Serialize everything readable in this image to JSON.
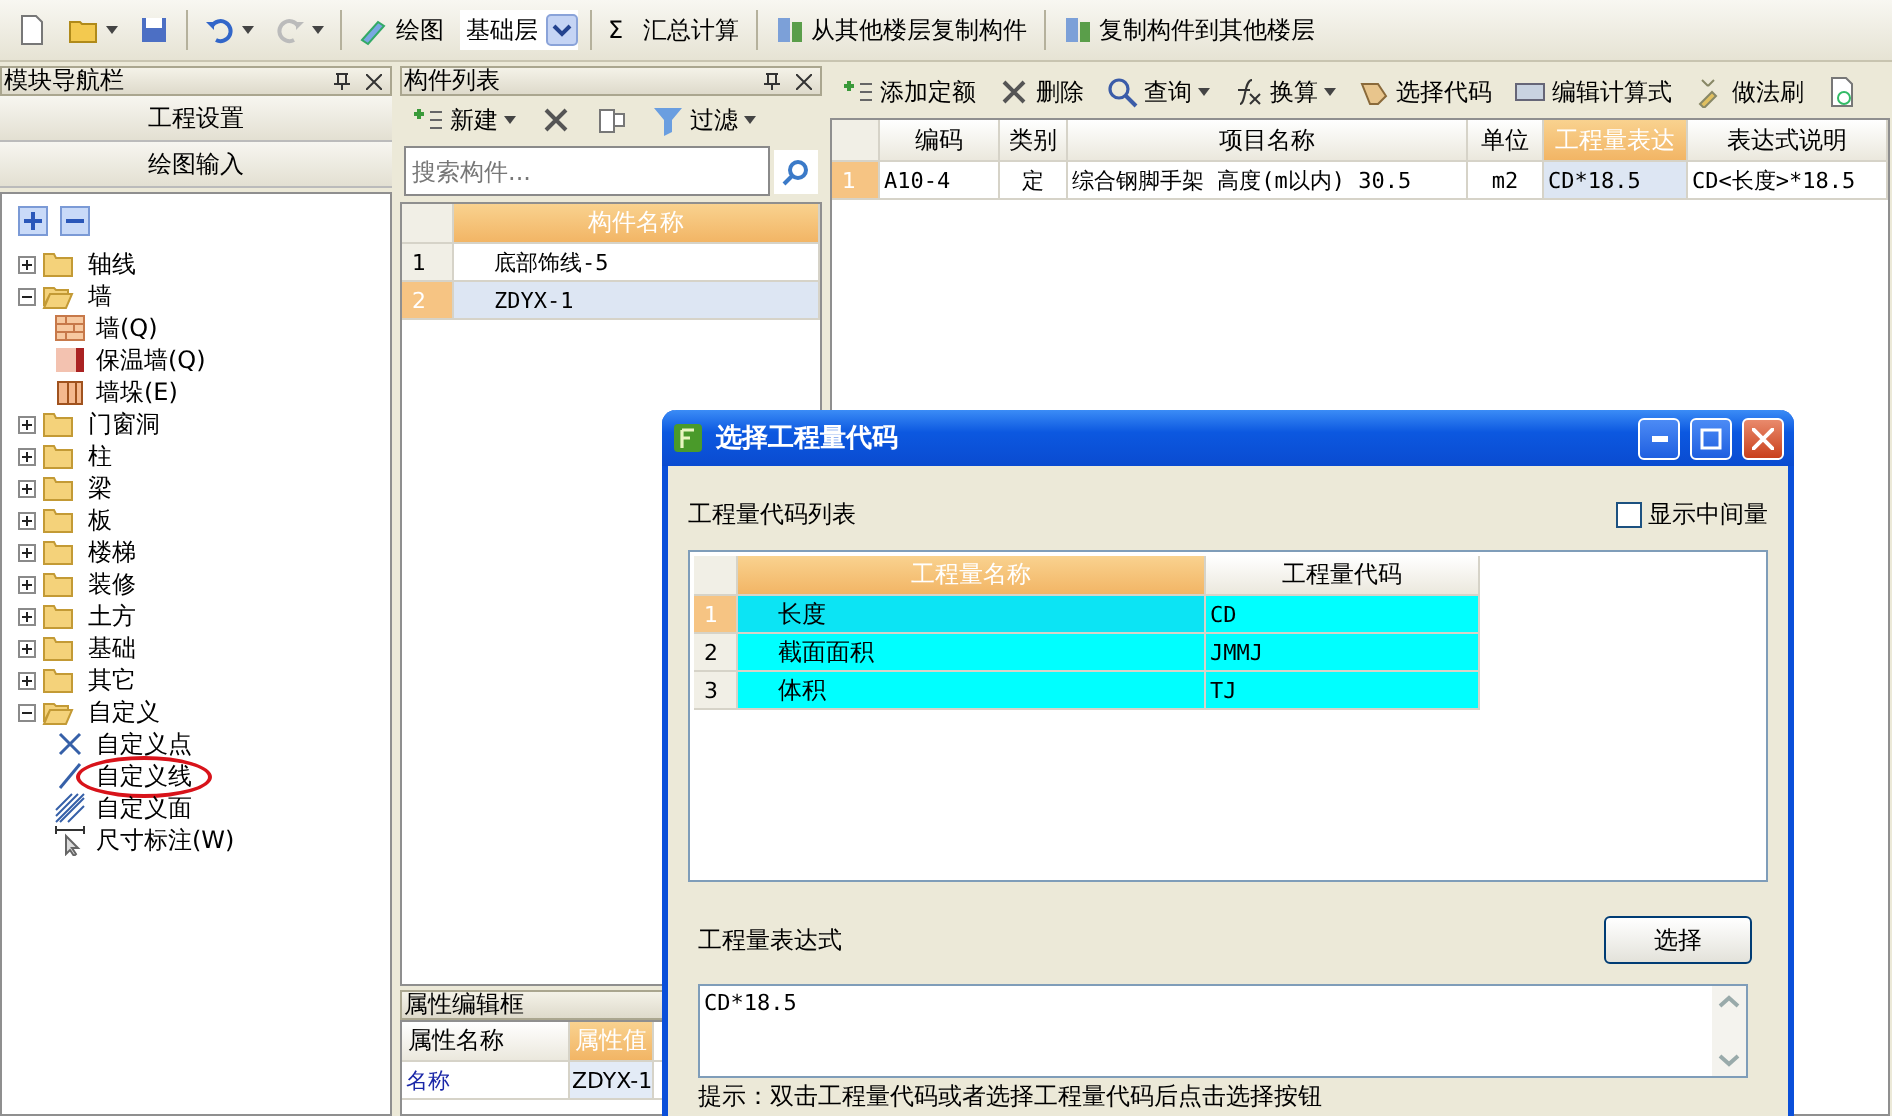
{
  "main_toolbar": {
    "redo_disabled": true,
    "draw": "绘图",
    "floor": "基础层",
    "sum_symbol": "Σ",
    "sum": "汇总计算",
    "copy_from": "从其他楼层复制构件",
    "copy_to": "复制构件到其他楼层"
  },
  "nav_panel": {
    "title": "模块导航栏",
    "sections": [
      "工程设置",
      "绘图输入"
    ],
    "tree": [
      {
        "label": "轴线",
        "kind": "folder",
        "expanded": false
      },
      {
        "label": "墙",
        "kind": "folder",
        "expanded": true,
        "children": [
          {
            "label": "墙(Q)",
            "kind": "wall"
          },
          {
            "label": "保温墙(Q)",
            "kind": "insulation"
          },
          {
            "label": "墙垛(E)",
            "kind": "pier"
          }
        ]
      },
      {
        "label": "门窗洞",
        "kind": "folder",
        "expanded": false
      },
      {
        "label": "柱",
        "kind": "folder",
        "expanded": false
      },
      {
        "label": "梁",
        "kind": "folder",
        "expanded": false
      },
      {
        "label": "板",
        "kind": "folder",
        "expanded": false
      },
      {
        "label": "楼梯",
        "kind": "folder",
        "expanded": false
      },
      {
        "label": "装修",
        "kind": "folder",
        "expanded": false
      },
      {
        "label": "土方",
        "kind": "folder",
        "expanded": false
      },
      {
        "label": "基础",
        "kind": "folder",
        "expanded": false
      },
      {
        "label": "其它",
        "kind": "folder",
        "expanded": false
      },
      {
        "label": "自定义",
        "kind": "folder",
        "expanded": true,
        "children": [
          {
            "label": "自定义点",
            "kind": "point",
            "circled": false
          },
          {
            "label": "自定义线",
            "kind": "line",
            "circled": true
          },
          {
            "label": "自定义面",
            "kind": "area",
            "circled": false
          },
          {
            "label": "尺寸标注(W)",
            "kind": "dimension",
            "circled": false
          }
        ]
      }
    ]
  },
  "component_panel": {
    "title": "构件列表",
    "new_label": "新建",
    "filter_label": "过滤",
    "search": {
      "placeholder": "搜索构件..."
    },
    "column": "构件名称",
    "rows": [
      {
        "index": "1",
        "name": "底部饰线-5",
        "selected": false
      },
      {
        "index": "2",
        "name": "ZDYX-1",
        "selected": true
      }
    ]
  },
  "property_panel": {
    "title": "属性编辑框",
    "columns": [
      "属性名称",
      "属性值"
    ],
    "rows": [
      {
        "name": "名称",
        "value": "ZDYX-1"
      }
    ]
  },
  "quota_panel": {
    "toolbar": [
      "添加定额",
      "删除",
      "查询",
      "换算",
      "选择代码",
      "编辑计算式",
      "做法刷"
    ],
    "columns": [
      {
        "label": "编码",
        "selected": false
      },
      {
        "label": "类别",
        "selected": false
      },
      {
        "label": "项目名称",
        "selected": false
      },
      {
        "label": "单位",
        "selected": false
      },
      {
        "label": "工程量表达",
        "selected": true
      },
      {
        "label": "表达式说明",
        "selected": false
      }
    ],
    "rows": [
      {
        "index": "1",
        "selected": true,
        "cells": [
          "A10-4",
          "定",
          "综合钢脚手架 高度(m以内) 30.5",
          "m2",
          "CD*18.5",
          "CD<长度>*18.5"
        ]
      }
    ]
  },
  "dialog": {
    "title": "选择工程量代码",
    "list_label": "工程量代码列表",
    "show_intermediate": {
      "label": "显示中间量",
      "checked": false
    },
    "columns": [
      "工程量名称",
      "工程量代码"
    ],
    "rows": [
      {
        "index": "1",
        "name": "长度",
        "code": "CD",
        "selected": true
      },
      {
        "index": "2",
        "name": "截面面积",
        "code": "JMMJ",
        "selected": false
      },
      {
        "index": "3",
        "name": "体积",
        "code": "TJ",
        "selected": false
      }
    ],
    "expression_label": "工程量表达式",
    "select_button": "选择",
    "expression": "CD*18.5",
    "hint": "提示：双击工程量代码或者选择工程量代码后点击选择按钮"
  }
}
